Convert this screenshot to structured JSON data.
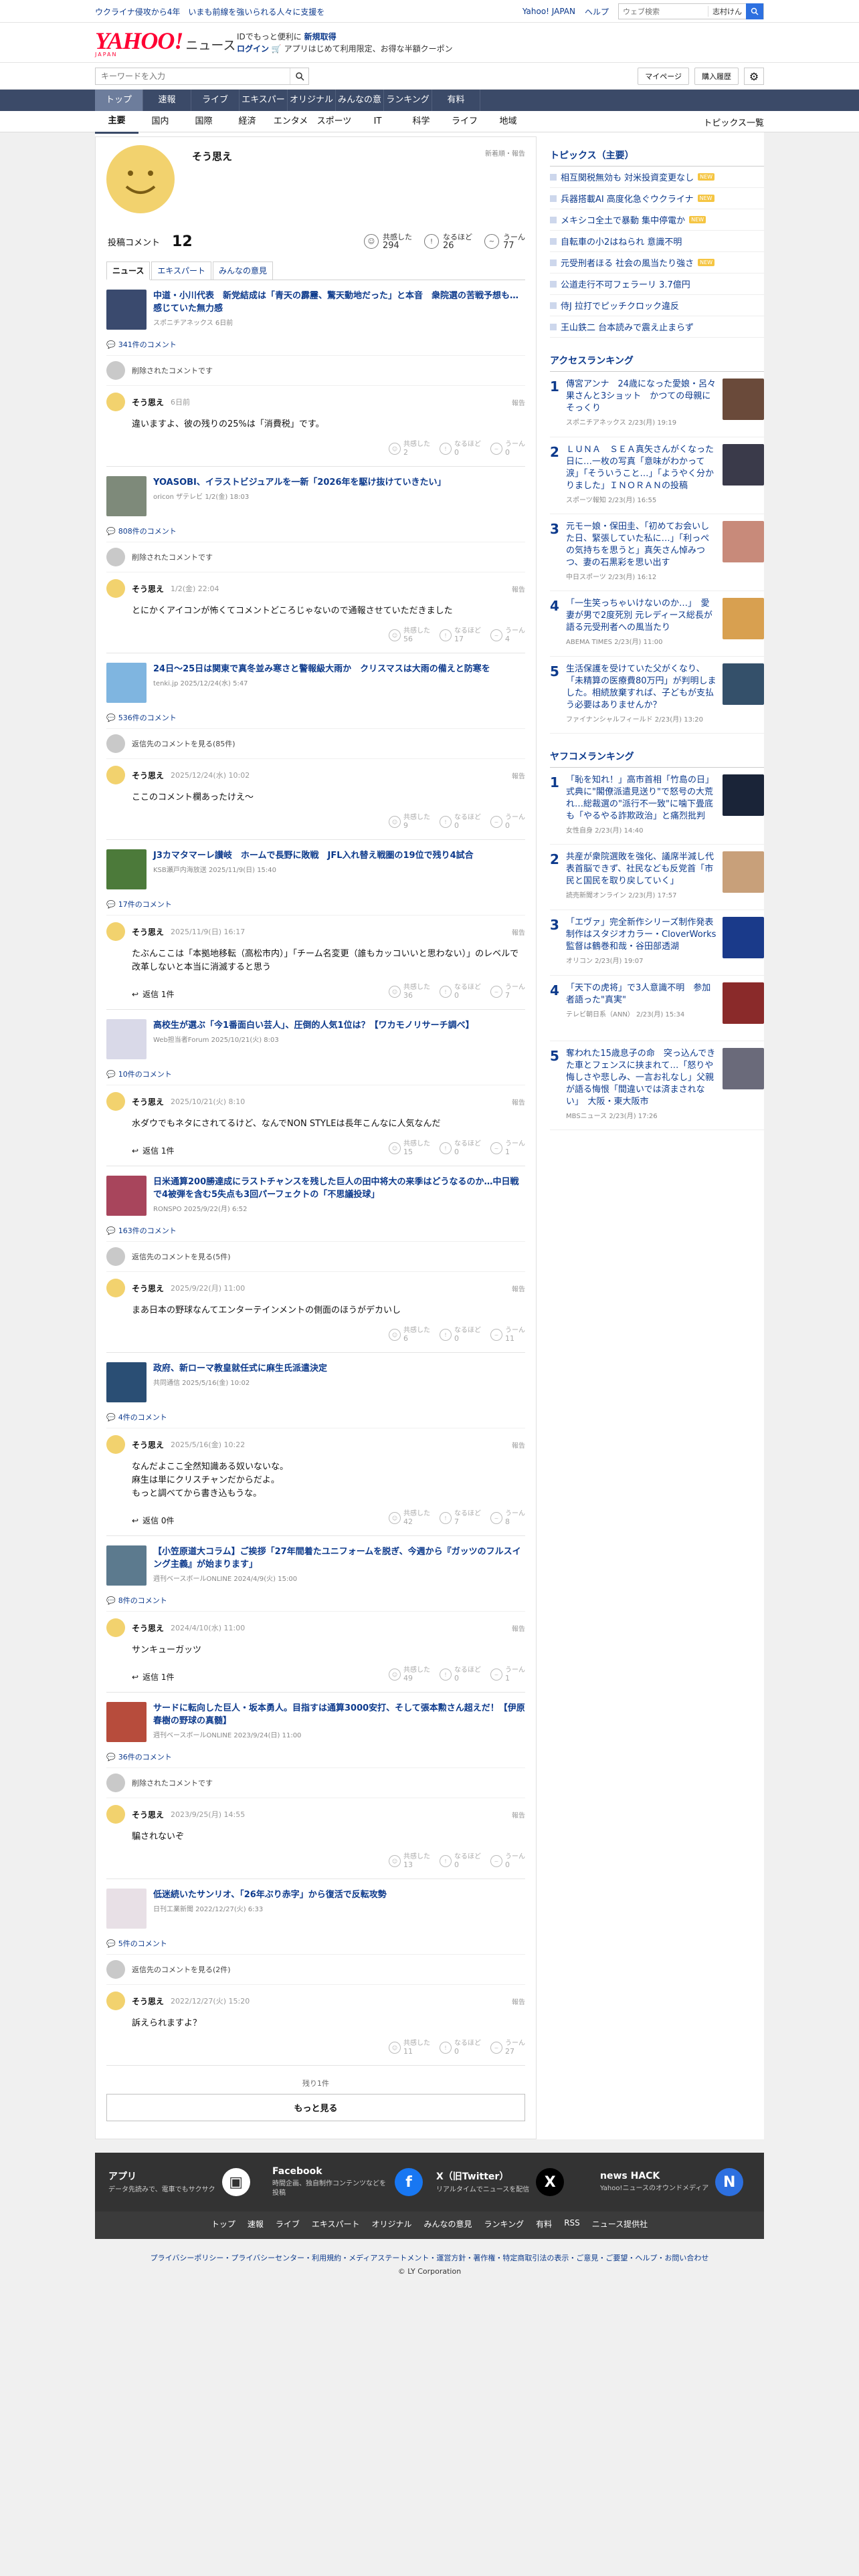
{
  "topstrip": {
    "left": "ウクライナ侵攻から4年　いまも前線を強いられる人々に支援を",
    "links": [
      "Yahoo! JAPAN",
      "ヘルプ"
    ],
    "search_placeholder": "ウェブ検索",
    "location": "志村けん"
  },
  "header": {
    "logo": "YAHOO!",
    "logo_sub": "JAPAN",
    "news": "ニュース",
    "promo1": "IDでもっと便利に",
    "promo1b": "新規取得",
    "promo2a": "ログイン",
    "promo2b": "アプリはじめて利用限定、お得な半額クーポン"
  },
  "searchbar": {
    "placeholder": "キーワードを入力",
    "mypage": "マイページ",
    "history": "購入履歴"
  },
  "catnav": [
    "トップ",
    "速報",
    "ライブ",
    "エキスパート",
    "オリジナル",
    "みんなの意見",
    "ランキング",
    "有料"
  ],
  "subnav": [
    "主要",
    "国内",
    "国際",
    "経済",
    "エンタメ",
    "スポーツ",
    "IT",
    "科学",
    "ライフ",
    "地域"
  ],
  "subnav_right": "トピックス一覧",
  "profile": {
    "name": "そう思え",
    "news_order": "新着順・報告",
    "comments_label": "投稿コメント",
    "comments": "12",
    "reacts": [
      {
        "label": "共感した",
        "value": "294"
      },
      {
        "label": "なるほど",
        "value": "26"
      },
      {
        "label": "うーん",
        "value": "77"
      }
    ]
  },
  "tabs": [
    "ニュース",
    "エキスパート",
    "みんなの意見"
  ],
  "labels": {
    "reply_btn": "返信 1件",
    "reply_btn0": "返信 0件",
    "report": "報告",
    "deleted": "削除されたコメントです",
    "empathy": "共感した",
    "naruhodo": "なるほど",
    "uun": "うーん"
  },
  "posts": [
    {
      "title": "中道・小川代表　新党結成は「青天の霹靂、驚天動地だった」と本音　衆院選の苦戦予想も…感じていた無力感",
      "source": "スポニチアネックス 6日前",
      "count": "341件のコメント",
      "prefix": "削除されたコメントです",
      "date": "6日前",
      "body": "違いますよ、彼の残りの25%は「消費税」です。",
      "reply": "",
      "r": [
        "2",
        "0",
        "0"
      ]
    },
    {
      "title": "YOASOBI、イラストビジュアルを一新「2026年を駆け抜けていきたい」",
      "source": "oricon ザテレビ 1/2(金) 18:03",
      "count": "808件のコメント",
      "prefix": "削除されたコメントです",
      "date": "1/2(金) 22:04",
      "body": "とにかくアイコンが怖くてコメントどころじゃないので通報させていただきました",
      "reply": "",
      "r": [
        "56",
        "17",
        "4"
      ]
    },
    {
      "title": "24日～25日は関東で真冬並み寒さと警報級大雨か　クリスマスは大雨の備えと防寒を",
      "source": "tenki.jp 2025/12/24(水) 5:47",
      "count": "536件のコメント",
      "prefix": "返信先のコメントを見る(85件)",
      "date": "2025/12/24(水) 10:02",
      "body": "ここのコメント欄あったけえ〜",
      "reply": "",
      "r": [
        "9",
        "0",
        "0"
      ]
    },
    {
      "title": "J3カマタマーレ讃岐　ホームで長野に敗戦　JFL入れ替え戦圏の19位で残り4試合",
      "source": "KSB瀬戸内海放送 2025/11/9(日) 15:40",
      "count": "17件のコメント",
      "prefix": "",
      "date": "2025/11/9(日) 16:17",
      "body": "たぶんここは「本拠地移転（高松市内）」「チーム名変更（誰もカッコいいと思わない）」のレベルで改革しないと本当に消滅すると思う",
      "reply": "返信 1件",
      "r": [
        "36",
        "0",
        "7"
      ]
    },
    {
      "title": "高校生が選ぶ「今1番面白い芸人」、圧倒的人気1位は？【ワカモノリサーチ調べ】",
      "source": "Web担当者Forum 2025/10/21(火) 8:03",
      "count": "10件のコメント",
      "prefix": "",
      "date": "2025/10/21(火) 8:10",
      "body": "水ダウでもネタにされてるけど、なんでNON STYLEは長年こんなに人気なんだ",
      "reply": "返信 1件",
      "r": [
        "15",
        "0",
        "1"
      ]
    },
    {
      "title": "日米通算200勝達成にラストチャンスを残した巨人の田中将大の来季はどうなるのか…中日戦で4被弾を含む5失点も3回パーフェクトの「不思議投球」",
      "source": "RONSPO 2025/9/22(月) 6:52",
      "count": "163件のコメント",
      "prefix": "返信先のコメントを見る(5件)",
      "date": "2025/9/22(月) 11:00",
      "body": "まあ日本の野球なんてエンターテインメントの側面のほうがデカいし",
      "reply": "",
      "r": [
        "6",
        "0",
        "11"
      ]
    },
    {
      "title": "政府、新ローマ教皇就任式に麻生氏派遣決定",
      "source": "共同通信 2025/5/16(金) 10:02",
      "count": "4件のコメント",
      "prefix": "",
      "date": "2025/5/16(金) 10:22",
      "body": "なんだよここ全然知識ある奴いないな。\n麻生は単にクリスチャンだからだよ。\nもっと調べてから書き込もうな。",
      "reply": "返信 0件",
      "r": [
        "42",
        "7",
        "8"
      ]
    },
    {
      "title": "【小笠原道大コラム】ご挨拶「27年間着たユニフォームを脱ぎ、今週から『ガッツのフルスイング主義』が始まります」",
      "source": "週刊ベースボールONLINE 2024/4/9(火) 15:00",
      "count": "8件のコメント",
      "prefix": "",
      "date": "2024/4/10(水) 11:00",
      "body": "サンキューガッツ",
      "reply": "返信 1件",
      "r": [
        "49",
        "0",
        "1"
      ]
    },
    {
      "title": "サードに転向した巨人・坂本勇人。目指すは通算3000安打、そして張本勲さん超えだ！【伊原春樹の野球の真髄】",
      "source": "週刊ベースボールONLINE 2023/9/24(日) 11:00",
      "count": "36件のコメント",
      "prefix": "削除されたコメントです",
      "date": "2023/9/25(月) 14:55",
      "body": "騙されないぞ",
      "reply": "",
      "r": [
        "13",
        "0",
        "0"
      ]
    },
    {
      "title": "低迷続いたサンリオ、「26年ぶり赤字」から復活で反転攻勢",
      "source": "日刊工業新聞 2022/12/27(火) 6:33",
      "count": "5件のコメント",
      "prefix": "返信先のコメントを見る(2件)",
      "date": "2022/12/27(火) 15:20",
      "body": "訴えられますよ？",
      "reply": "",
      "r": [
        "11",
        "0",
        "27"
      ]
    }
  ],
  "more_count": "残り1件",
  "more_btn": "もっと見る",
  "side": {
    "topics_title": "トピックス（主要）",
    "topics": [
      {
        "t": "相互関税無効も 対米投資変更なし",
        "b": "NEW"
      },
      {
        "t": "兵器搭載AI 高度化急ぐウクライナ",
        "b": "NEW"
      },
      {
        "t": "メキシコ全土で暴動 集中停電か",
        "b": "NEW"
      },
      {
        "t": "自転車の小2はねられ 意識不明",
        "b": ""
      },
      {
        "t": "元受刑者ほる 社会の風当たり強さ",
        "b": "NEW"
      },
      {
        "t": "公道走行不可フェラーリ 3.7億円",
        "b": ""
      },
      {
        "t": "侍J 拉打でピッチクロック違反",
        "b": ""
      },
      {
        "t": "王山鉄二 台本読みで震え止まらず",
        "b": ""
      }
    ],
    "access_title": "アクセスランキング",
    "access": [
      {
        "t": "傳宮アンナ　24歳になった愛娘・呂々果さんと3ショット　かつての母親にそっくり",
        "s": "スポニチアネックス 2/23(月) 19:19"
      },
      {
        "t": "ＬＵＮＡ　ＳＥＡ真矢さんがくなった日に…一枚の写真「意味がわかって涙」「そういうこと…」「ようやく分かりました」ＩＮＯＲＡＮの投稿",
        "s": "スポーツ報知 2/23(月) 16:55"
      },
      {
        "t": "元モー娘・保田圭、「初めてお会いした日、緊張していた私に…」「利っぺの気持ちを思うと」真矢さん悼みつつ、妻の石黒彩を思い出す",
        "s": "中日スポーツ 2/23(月) 16:12"
      },
      {
        "t": "「一生笑っちゃいけないのか…」　愛妻が男で2度死別 元レディース総長が語る元受刑者への風当たり",
        "s": "ABEMA TIMES 2/23(月) 11:00"
      },
      {
        "t": "生活保護を受けていた父がくなり、「未精算の医療費80万円」が判明しました。相続放棄すれば、子どもが支払う必要はありませんか？",
        "s": "ファイナンシャルフィールド 2/23(月) 13:20"
      }
    ],
    "yahoo_title": "ヤフコメランキング",
    "yahoo": [
      {
        "t": "「恥を知れ！」高市首相「竹島の日」式典に\"閣僚派遣見送り\"で怒号の大荒れ…総裁選の\"派行不一致\"に噛下畳底も「やるやる詐欺政治」と痛烈批判",
        "s": "女性自身 2/23(月) 14:40"
      },
      {
        "t": "共産が衆院選敗を強化、議席半減し代表首脳できず、社民なども反党首「市民と国民を取り戻していく」",
        "s": "読売新聞オンライン 2/23(月) 17:57"
      },
      {
        "t": "「エヴァ」完全新作シリーズ制作発表　制作はスタジオカラー・CloverWorks　監督は鶴巻和哉・谷田部透湖",
        "s": "オリコン 2/23(月) 19:07"
      },
      {
        "t": "「天下の虎将」で3人意識不明　参加者語った\"真実\"",
        "s": "テレビ朝日系（ANN） 2/23(月) 15:34"
      },
      {
        "t": "奪われた15歳息子の命　突っ込んできた車とフェンスに挟まれて…「怒りや悔しさや悲しみ、一言お礼なし」父親が語る悔恨「間違いでは済まされない」　大阪・東大阪市",
        "s": "MBSニュース 2/23(月) 17:26"
      }
    ]
  },
  "footer": {
    "apps": [
      {
        "name": "アプリ",
        "desc": "データ先読みで、電車でもサクサク"
      },
      {
        "name": "Facebook",
        "desc": "時間企画、独自制作コンテンツなどを投稿"
      },
      {
        "name": "X（旧Twitter）",
        "desc": "リアルタイムでニュースを配信"
      },
      {
        "name": "news HACK",
        "desc": "Yahoo!ニュースのオウンドメディア"
      }
    ],
    "nav": [
      "トップ",
      "速報",
      "ライブ",
      "エキスパート",
      "オリジナル",
      "みんなの意見",
      "ランキング",
      "有料",
      "RSS",
      "ニュース提供社"
    ],
    "legal": "プライバシーポリシー・プライバシーセンター・利用規約・メディアステートメント・運営方針・著作権・特定商取引法の表示・ご意見・ご要望・ヘルプ・お問い合わせ",
    "copy": "© LY Corporation"
  },
  "colors": {
    "accent": "#0d3a8c",
    "nav": "#3b4a68",
    "yahoo_red": "#ff0033"
  }
}
